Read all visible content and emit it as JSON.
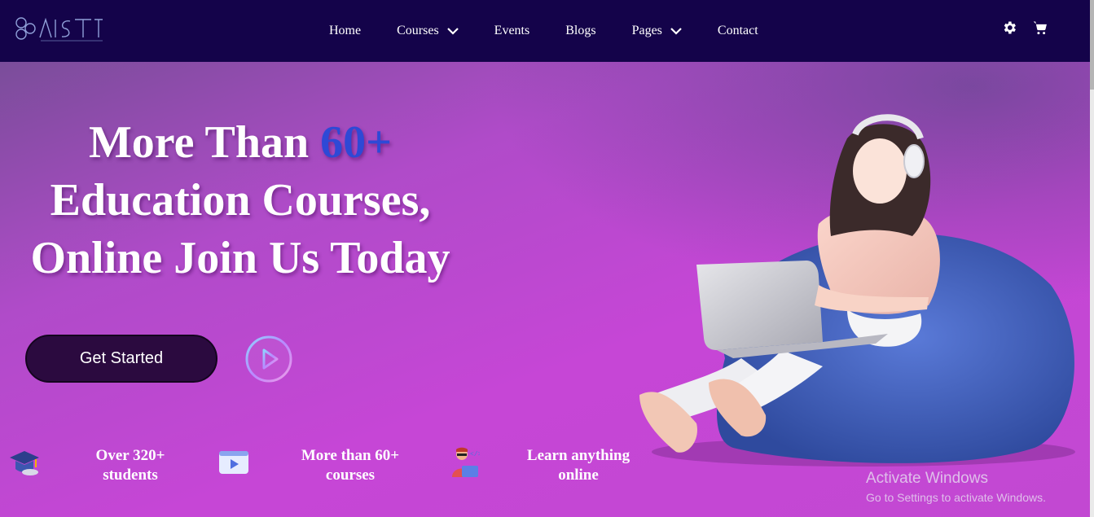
{
  "nav": {
    "items": [
      {
        "label": "Home"
      },
      {
        "label": "Courses"
      },
      {
        "label": "Events"
      },
      {
        "label": "Blogs"
      },
      {
        "label": "Pages"
      },
      {
        "label": "Contact"
      }
    ],
    "icons": [
      "gear-icon",
      "cart-icon"
    ]
  },
  "hero": {
    "line1_pre": "More Than ",
    "line1_accent": "60+",
    "line2": "Education Courses,",
    "line3": "Online Join Us Today",
    "cta_label": "Get Started"
  },
  "stats": [
    {
      "label_line1": "Over 320+",
      "label_line2": "students",
      "icon": "graduation-cap-icon"
    },
    {
      "label_line1": "More than 60+",
      "label_line2": "courses",
      "icon": "video-player-icon"
    },
    {
      "label_line1": "Learn anything",
      "label_line2": "online",
      "icon": "developer-icon"
    }
  ],
  "watermark": {
    "title": "Activate Windows",
    "subtitle": "Go to Settings to activate Windows."
  },
  "colors": {
    "nav_bg": "#14034a",
    "hero_bg": "#c346d4",
    "accent": "#2e49d6",
    "button_bg": "#2b0a3f"
  }
}
